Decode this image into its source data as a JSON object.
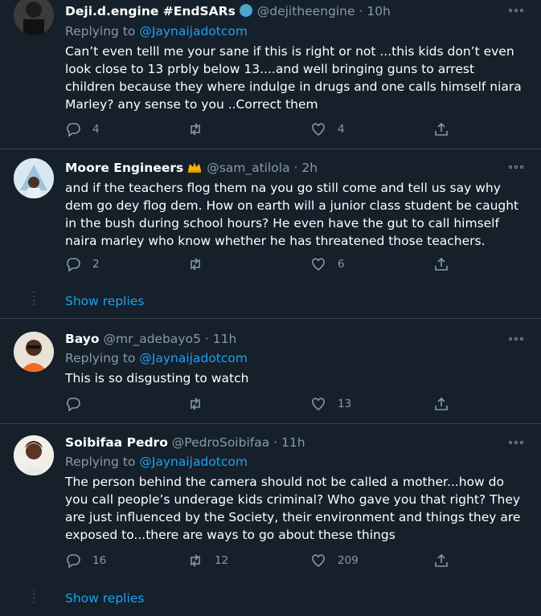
{
  "tweets": [
    {
      "name": "Deji.d.engine #EndSARs",
      "handle": "@dejitheengine",
      "sep": " · ",
      "time": "10h",
      "replying_prefix": "Replying to ",
      "replying_to": "@Jaynaijadotcom",
      "text": "Can’t even telll me your sane if this is right or not ...this kids don’t even look close to 13 prbly below 13....and well bringing guns to arrest children because they where indulge in drugs and one calls himself niara Marley? any sense to you ..Correct them",
      "replies": "4",
      "retweets": "",
      "likes": "4"
    },
    {
      "name": "Moore Engineers",
      "handle": "@sam_atilola",
      "sep": " · ",
      "time": "2h",
      "text": "and if the teachers flog them na you go still come and tell us say why dem go dey flog dem. How on earth will a junior class student be caught in the bush during school hours? He even have the gut to call himself naira marley who know whether he has threatened those teachers.",
      "replies": "2",
      "retweets": "",
      "likes": "6"
    },
    {
      "name": "Bayo",
      "handle": "@mr_adebayo5",
      "sep": " · ",
      "time": "11h",
      "replying_prefix": "Replying to ",
      "replying_to": "@Jaynaijadotcom",
      "text": "This is so disgusting to watch",
      "replies": "",
      "retweets": "",
      "likes": "13"
    },
    {
      "name": "Soibifaa Pedro",
      "handle": "@PedroSoibifaa",
      "sep": " · ",
      "time": "11h",
      "replying_prefix": "Replying to ",
      "replying_to": "@Jaynaijadotcom",
      "text": "The person behind the camera should not be called a mother...how do you call people’s underage kids criminal? Who gave you that right? They are just influenced by the Society, their environment and things they are exposed to...there are ways to go about these things",
      "replies": "16",
      "retweets": "12",
      "likes": "209"
    }
  ],
  "show_replies_label": "Show replies",
  "icons": {
    "reply": "reply-icon",
    "retweet": "retweet-icon",
    "like": "heart-icon",
    "share": "share-icon",
    "more": "more-dots-icon",
    "globe": "globe-emoji-icon",
    "crown": "crown-emoji-icon"
  },
  "colors": {
    "background": "#15202b",
    "secondary_text": "#8899a6",
    "link": "#1da1f2",
    "divider": "#38444d"
  }
}
